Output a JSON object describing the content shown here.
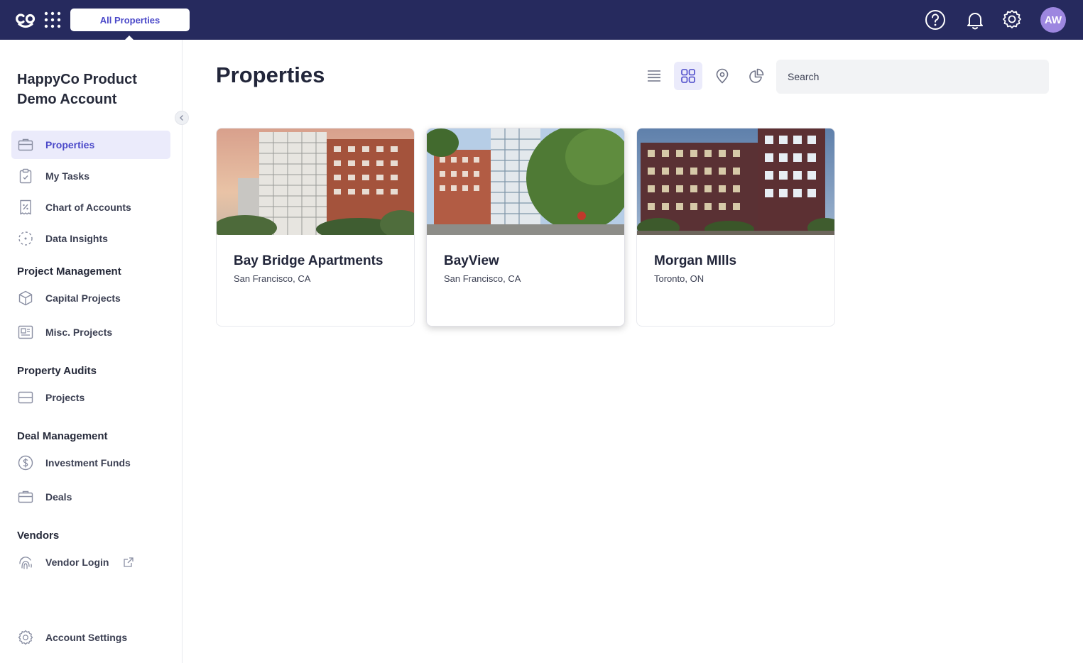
{
  "topbar": {
    "scope_label": "All Properties",
    "avatar_initials": "AW",
    "colors": {
      "bar": "#262a5e",
      "accent": "#4b49c9",
      "avatar": "#9d87e0"
    }
  },
  "sidebar": {
    "account_name": "HappyCo Product Demo Account",
    "items_top": [
      {
        "label": "Properties",
        "icon": "briefcase-icon",
        "active": true
      },
      {
        "label": "My Tasks",
        "icon": "clipboard-check-icon"
      },
      {
        "label": "Chart of Accounts",
        "icon": "receipt-icon"
      },
      {
        "label": "Data Insights",
        "icon": "insights-icon"
      }
    ],
    "sections": [
      {
        "title": "Project Management",
        "items": [
          {
            "label": "Capital Projects",
            "icon": "cube-icon"
          },
          {
            "label": "Misc. Projects",
            "icon": "document-icon"
          }
        ]
      },
      {
        "title": "Property Audits",
        "items": [
          {
            "label": "Projects",
            "icon": "card-icon"
          }
        ]
      },
      {
        "title": "Deal Management",
        "items": [
          {
            "label": "Investment Funds",
            "icon": "dollar-icon"
          },
          {
            "label": "Deals",
            "icon": "briefcase-icon"
          }
        ]
      },
      {
        "title": "Vendors",
        "items": [
          {
            "label": "Vendor Login",
            "icon": "fingerprint-icon"
          }
        ]
      }
    ],
    "account_settings": "Account Settings"
  },
  "main": {
    "title": "Properties",
    "search_placeholder": "Search",
    "views": [
      "list-view-icon",
      "grid-view-icon",
      "map-pin-icon",
      "pie-chart-icon"
    ],
    "active_view": "grid-view-icon",
    "properties": [
      {
        "name": "Bay Bridge Apartments",
        "location": "San Francisco, CA"
      },
      {
        "name": "BayView",
        "location": "San Francisco, CA"
      },
      {
        "name": "Morgan MIlls",
        "location": "Toronto, ON"
      }
    ]
  }
}
